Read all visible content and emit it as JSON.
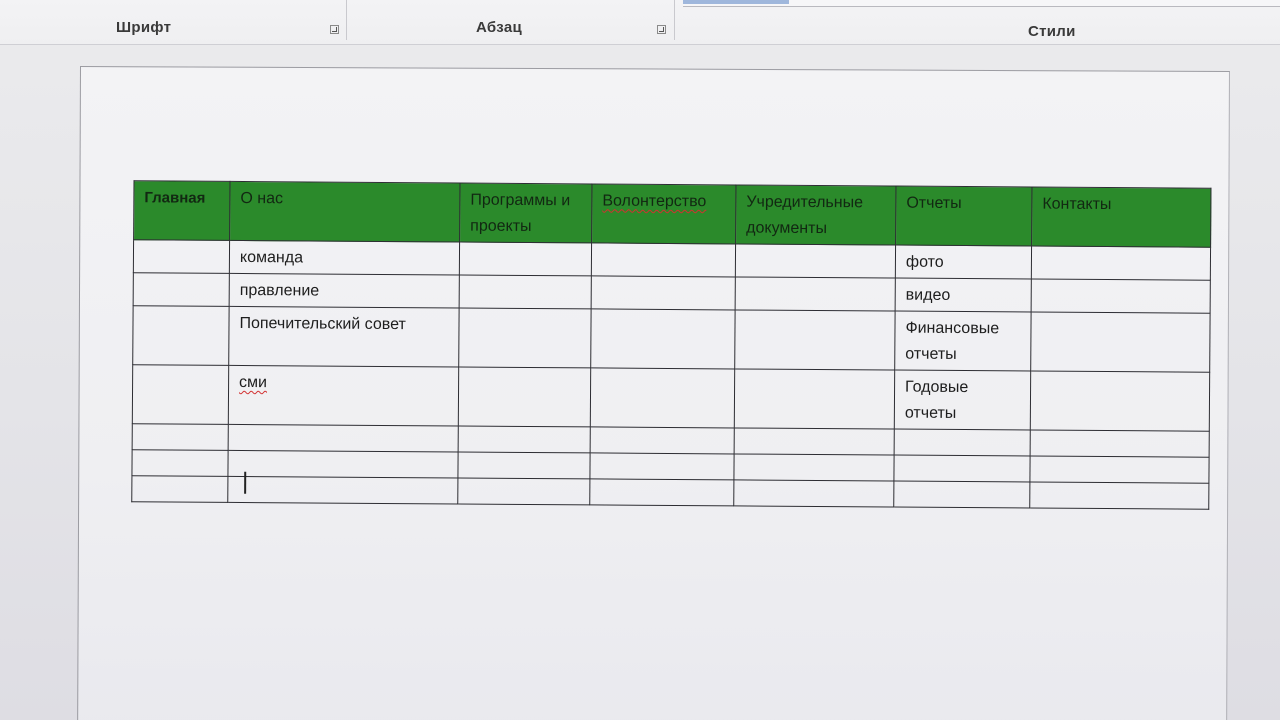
{
  "ribbon": {
    "groups": [
      {
        "label": "Шрифт"
      },
      {
        "label": "Абзац"
      },
      {
        "label": "Стили"
      }
    ]
  },
  "table": {
    "headers": [
      "Главная",
      "О нас",
      "Программы и проекты",
      "Волонтерство",
      "Учредительные документы",
      "Отчеты",
      "Контакты"
    ],
    "rows": [
      [
        "",
        "команда",
        "",
        "",
        "",
        "фото",
        ""
      ],
      [
        "",
        "правление",
        "",
        "",
        "",
        "видео",
        ""
      ],
      [
        "",
        "Попечительский совет",
        "",
        "",
        "",
        "Финансовые отчеты",
        ""
      ],
      [
        "",
        "сми",
        "",
        "",
        "",
        "Годовые отчеты",
        ""
      ],
      [
        "",
        "",
        "",
        "",
        "",
        "",
        ""
      ],
      [
        "",
        "",
        "",
        "",
        "",
        "",
        ""
      ],
      [
        "",
        "",
        "",
        "",
        "",
        "",
        ""
      ]
    ]
  },
  "colors": {
    "header_bg": "#2b8a2b",
    "spellcheck_underline": "#d23030"
  }
}
